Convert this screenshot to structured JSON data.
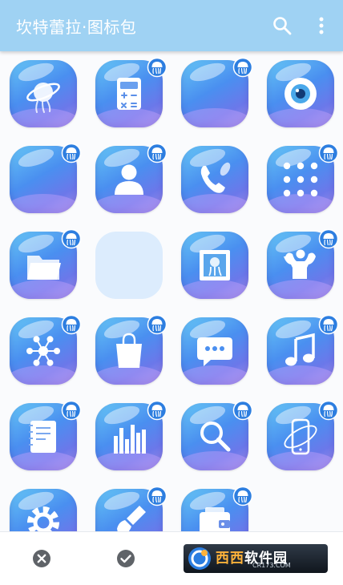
{
  "app": {
    "title": "坎特蕾拉·图标包"
  },
  "toolbar": {
    "search_icon": "search-icon",
    "more_icon": "more-vert-icon"
  },
  "colors": {
    "app_bar": "#9fd2f3",
    "tile_blue": "#4a8ff0",
    "tile_purple": "#a792ea",
    "empty_tile": "#dcecfd",
    "action_icon": "#5f6368"
  },
  "icons": [
    {
      "name": "jellyfish-planet",
      "glyph": "planet",
      "badge": false
    },
    {
      "name": "calculator",
      "glyph": "calculator",
      "badge": true
    },
    {
      "name": "blank-bubble-1",
      "glyph": "none",
      "badge": true
    },
    {
      "name": "camera-eye",
      "glyph": "eye",
      "badge": false
    },
    {
      "name": "blank-bubble-2",
      "glyph": "none",
      "badge": true
    },
    {
      "name": "contacts",
      "glyph": "person",
      "badge": true
    },
    {
      "name": "phone",
      "glyph": "phone",
      "badge": false
    },
    {
      "name": "app-drawer",
      "glyph": "dots",
      "badge": true
    },
    {
      "name": "files",
      "glyph": "folder",
      "badge": true
    },
    {
      "name": "empty-slot",
      "glyph": "empty",
      "badge": false
    },
    {
      "name": "gallery",
      "glyph": "photo",
      "badge": false
    },
    {
      "name": "fitness",
      "glyph": "muscle",
      "badge": true
    },
    {
      "name": "network",
      "glyph": "network",
      "badge": true
    },
    {
      "name": "store",
      "glyph": "bag",
      "badge": true
    },
    {
      "name": "messages",
      "glyph": "chat",
      "badge": false
    },
    {
      "name": "music",
      "glyph": "music",
      "badge": true
    },
    {
      "name": "notes",
      "glyph": "notebook",
      "badge": true
    },
    {
      "name": "equalizer",
      "glyph": "equalizer",
      "badge": true
    },
    {
      "name": "search",
      "glyph": "magnifier",
      "badge": true
    },
    {
      "name": "phone-manager",
      "glyph": "device",
      "badge": true
    },
    {
      "name": "settings",
      "glyph": "gear",
      "badge": false
    },
    {
      "name": "theme-brush",
      "glyph": "brush",
      "badge": true
    },
    {
      "name": "wallet",
      "glyph": "wallet",
      "badge": true
    }
  ],
  "bottom_bar": {
    "cancel_icon": "cancel-icon",
    "confirm_icon": "check-circle-icon"
  },
  "watermark": {
    "main_a": "西西",
    "main_b": "软件园",
    "sub": "CR173.COM"
  }
}
